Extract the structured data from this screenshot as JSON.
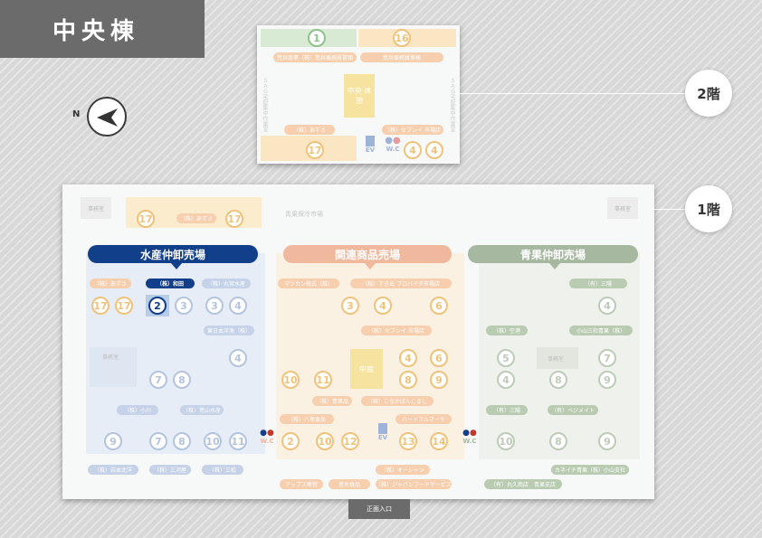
{
  "building": {
    "title": "中央棟"
  },
  "compass": {
    "label": "N"
  },
  "floors": {
    "second": "2階",
    "first": "1階"
  },
  "entrance": "正面入口",
  "colors": {
    "marine": "#123f8a",
    "marine_light": "#9fb3d8",
    "related": "#f0b89c",
    "produce": "#a7b8a0",
    "yellow": "#f5d58b",
    "green": "#cde5c8"
  },
  "floor2": {
    "top_left_num": "1",
    "top_right_num": "16",
    "pill_left": "荒井商事（株）荒井乗務員書類",
    "pill_right": "荒井乗務員事務",
    "side_left": "ＳＡＧ宅配集中作業室",
    "side_right": "ＳＡＧ宅配集中作業室",
    "center_label": "中央 休憩",
    "pill_bottom_left": "（株）あずさ",
    "pill_bottom_right": "（株）セブンイ 市場店",
    "bottom_num_left": "17",
    "ev": "EV",
    "wc": "W.C",
    "bottom_num_r1": "4",
    "bottom_num_r2": "4"
  },
  "floor1": {
    "top_left_box": "事務室",
    "top_right_box": "事務室",
    "top_nums": [
      "17",
      "17"
    ],
    "top_pill": "（株）あずさ",
    "top_center": "青果保冷市場",
    "headers": {
      "marine": "水産仲卸売場",
      "related": "関連商品売場",
      "produce": "青果仲卸売場"
    },
    "marine": {
      "pills_top": [
        "（株）あずさ",
        "（株）和田",
        "（株）丸宮水産"
      ],
      "nums_row1": [
        "17",
        "17",
        "2",
        "3",
        "3",
        "4"
      ],
      "pill_mid": "東日本洋漁（株）",
      "nums_row2": [
        "7",
        "8",
        "4"
      ],
      "office": "事務室",
      "pills_mid2": [
        "（株）小川",
        "（株）荒山水産"
      ],
      "nums_row3": [
        "9",
        "7",
        "8",
        "10",
        "11"
      ],
      "pills_bottom": [
        "（株）岩本北洋",
        "（株）三河屋",
        "（株）三松"
      ]
    },
    "related": {
      "pills_top": [
        "マツカン株式（株）",
        "（株）すき出 プロバイダ市場店"
      ],
      "nums_row1": [
        "3",
        "4",
        "6"
      ],
      "pill_mid": "（株）セブンイ 市場店",
      "nums_row2": [
        "4",
        "6"
      ],
      "center_label": "中庭",
      "nums_row3": [
        "10",
        "11",
        "8",
        "9"
      ],
      "pills_mid2": [
        "（株）青果品",
        "（株）こなかばんじまし"
      ],
      "pills_mid3": [
        "（株）八島食品",
        "ハートフルマーケ"
      ],
      "nums_row4": [
        "2",
        "10",
        "12",
        "13",
        "14"
      ],
      "ev": "EV",
      "wc_left": "W.C",
      "wc_right": "W.C",
      "pill_ev": "（株）オーシャン",
      "pills_bottom": [
        "アップス専営",
        "青木食品",
        "（株）ジャパンフードサービス"
      ]
    },
    "produce": {
      "pill_top": "（有）三陽",
      "nums_row1": [
        "4"
      ],
      "pills_mid": [
        "（株）空港",
        "小山三和青果（株）"
      ],
      "nums_row2": [
        "5",
        "7"
      ],
      "office": "事務室",
      "nums_row3": [
        "4",
        "8",
        "9"
      ],
      "pills_mid2": [
        "（有）三陽",
        "（有）ベジメイト"
      ],
      "nums_row4": [
        "10",
        "8",
        "9"
      ],
      "pill_bottom_right": "カネイチ青果（株）小山支社",
      "pill_bottom_left": "（有）丸久商店　青果支店"
    }
  }
}
